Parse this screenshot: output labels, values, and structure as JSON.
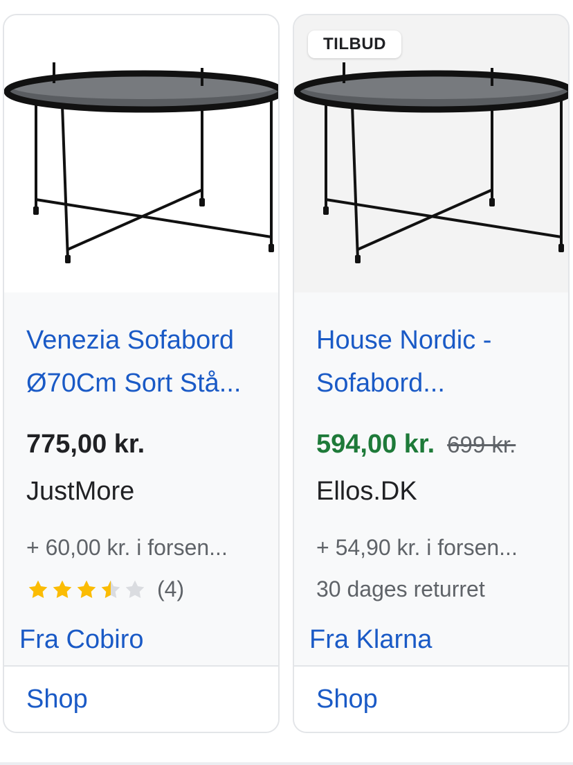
{
  "colors": {
    "link": "#1a5ac6",
    "sale_price": "#1e7a39",
    "star": "#fbbc04",
    "star_empty": "#dadce0"
  },
  "products": [
    {
      "image_icon": "coffee-table-image",
      "title_line1": "Venezia Sofabord",
      "title_line2": "Ø70Cm Sort Stå...",
      "price": "775,00 kr.",
      "seller": "JustMore",
      "shipping": "+ 60,00 kr. i forsen...",
      "rating": 3.5,
      "rating_max": 5,
      "review_count": "(4)",
      "source": "Fra Cobiro",
      "action": "Shop"
    },
    {
      "image_icon": "coffee-table-image",
      "badge": "TILBUD",
      "title_line1": "House Nordic -",
      "title_line2": "Sofabord...",
      "price": "594,00 kr.",
      "old_price": "699 kr.",
      "seller": "Ellos.DK",
      "shipping": "+ 54,90 kr. i forsen...",
      "returns": "30 dages returret",
      "source": "Fra Klarna",
      "action": "Shop"
    }
  ]
}
